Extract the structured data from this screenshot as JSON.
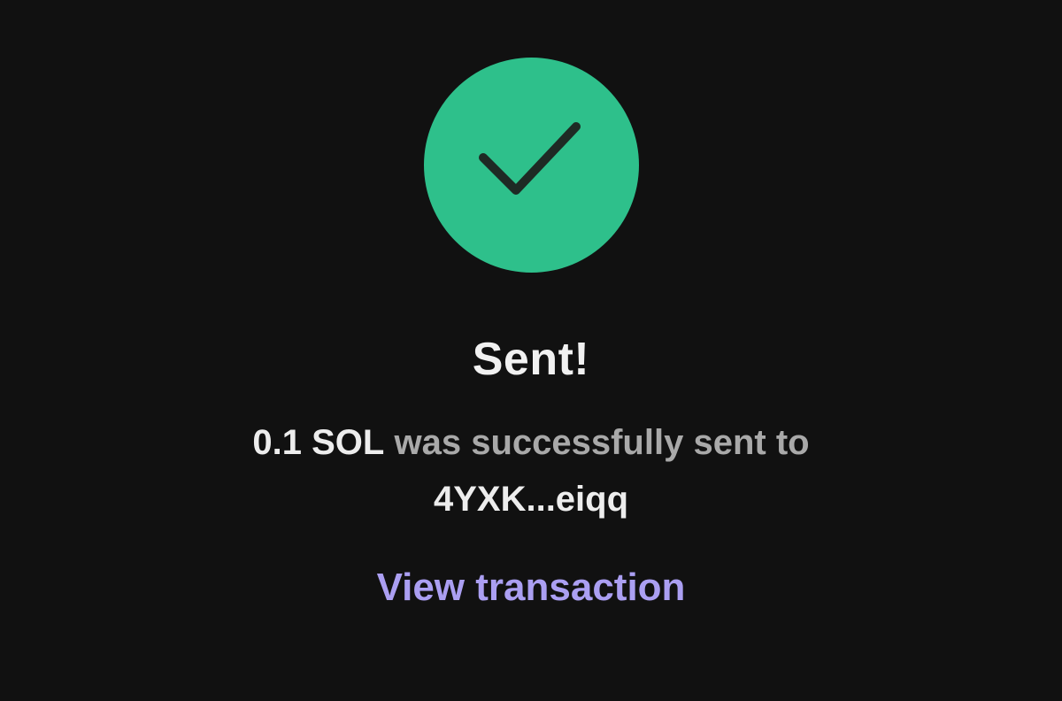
{
  "status": {
    "icon": "checkmark-icon",
    "color": "#2EC08B",
    "title": "Sent!"
  },
  "message": {
    "amount": "0.1 SOL",
    "text": "was successfully sent to",
    "recipient": "4YXK...eiqq"
  },
  "link": {
    "label": "View transaction",
    "color": "#AB9FF2"
  }
}
